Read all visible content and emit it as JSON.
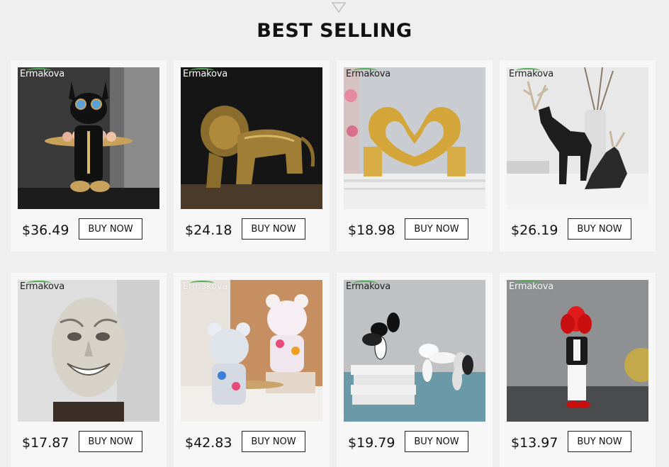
{
  "section": {
    "title": "BEST SELLING"
  },
  "products": [
    {
      "brand": "Ermakova",
      "price": "$36.49",
      "button": "BUY NOW",
      "image": "french-bulldog-butler-tray-statue"
    },
    {
      "brand": "Ermakova",
      "price": "$24.18",
      "button": "BUY NOW",
      "image": "golden-lion-statue"
    },
    {
      "brand": "Ermakova",
      "price": "$18.98",
      "button": "BUY NOW",
      "image": "gold-heart-hands-sculpture"
    },
    {
      "brand": "Ermakova",
      "price": "$26.19",
      "button": "BUY NOW",
      "image": "geometric-black-deer-figurines"
    },
    {
      "brand": "Ermakova",
      "price": "$17.87",
      "button": "BUY NOW",
      "image": "grinning-face-bust"
    },
    {
      "brand": "Ermakova",
      "price": "$42.83",
      "button": "BUY NOW",
      "image": "graffiti-bear-statues"
    },
    {
      "brand": "Ermakova",
      "price": "$19.79",
      "button": "BUY NOW",
      "image": "checkered-balloon-dogs"
    },
    {
      "brand": "Ermakova",
      "price": "$13.97",
      "button": "BUY NOW",
      "image": "balloon-head-figure"
    }
  ],
  "colors": {
    "background": "#efefef",
    "card": "#f7f7f7",
    "accent": "#4caf50"
  }
}
